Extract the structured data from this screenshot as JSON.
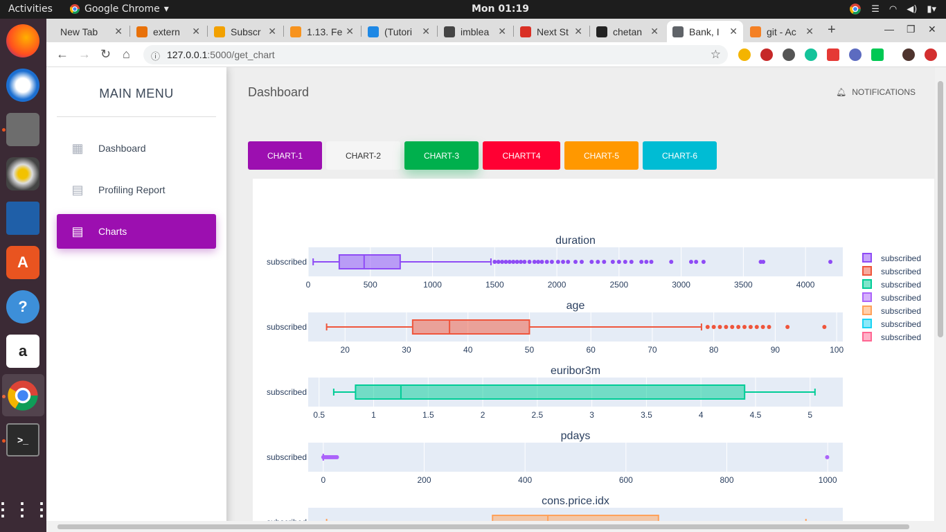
{
  "topbar": {
    "activities": "Activities",
    "app_name": "Google Chrome",
    "clock": "Mon 01:19"
  },
  "tabs": [
    {
      "label": "New Tab",
      "color": "#ffffff"
    },
    {
      "label": "extern",
      "color": "#e8710a"
    },
    {
      "label": "Subscr",
      "color": "#f2a100"
    },
    {
      "label": "1.13. Fe",
      "color": "#f7931e"
    },
    {
      "label": "(Tutori",
      "color": "#1e88e5"
    },
    {
      "label": "imblea",
      "color": "#444444"
    },
    {
      "label": "Next St",
      "color": "#d93025"
    },
    {
      "label": "chetan",
      "color": "#222222"
    },
    {
      "label": "Bank, I",
      "color": "#5f6368"
    },
    {
      "label": "git - Ac",
      "color": "#f48024"
    }
  ],
  "omnibox": {
    "host": "127.0.0.1",
    "path": ":5000/get_chart"
  },
  "sidebar": {
    "title": "MAIN MENU",
    "items": [
      {
        "label": "Dashboard",
        "icon": "dashboard-icon"
      },
      {
        "label": "Profiling Report",
        "icon": "report-icon"
      },
      {
        "label": "Charts",
        "icon": "charts-icon"
      }
    ]
  },
  "header": {
    "title": "Dashboard",
    "notifications": "NOTIFICATIONS"
  },
  "chart_buttons": [
    {
      "label": "CHART-1",
      "color": "#9c0fb0"
    },
    {
      "label": "CHART-2",
      "color": "#f5f5f5"
    },
    {
      "label": "CHART-3",
      "color": "#00b04d"
    },
    {
      "label": "CHARTT4",
      "color": "#ff0033"
    },
    {
      "label": "CHART-5",
      "color": "#ff9800"
    },
    {
      "label": "CHART-6",
      "color": "#00bcd4"
    }
  ],
  "chart_data": {
    "type": "box",
    "category_label": "subscribed",
    "legend": [
      "subscribed",
      "subscribed",
      "subscribed",
      "subscribed",
      "subscribed",
      "subscribed",
      "subscribed"
    ],
    "legend_colors": [
      "#8e4bf5",
      "#ef553b",
      "#00cc96",
      "#ab63fa",
      "#ffa15a",
      "#19d3f3",
      "#ff6692"
    ],
    "subplots": [
      {
        "title": "duration",
        "color": "#8e4bf5",
        "xlim": [
          0,
          4300
        ],
        "ticks": [
          0,
          500,
          1000,
          1500,
          2000,
          2500,
          3000,
          3500,
          4000
        ],
        "min": 40,
        "q1": 250,
        "median": 450,
        "q3": 740,
        "max": 1470,
        "outliers": [
          1500,
          1530,
          1560,
          1590,
          1620,
          1650,
          1680,
          1710,
          1740,
          1780,
          1820,
          1850,
          1880,
          1920,
          1960,
          2010,
          2050,
          2090,
          2150,
          2200,
          2280,
          2330,
          2380,
          2450,
          2500,
          2550,
          2600,
          2680,
          2720,
          2760,
          2920,
          3080,
          3120,
          3180,
          3640,
          3660,
          4200
        ]
      },
      {
        "title": "age",
        "color": "#ef553b",
        "xlim": [
          14,
          101
        ],
        "ticks": [
          20,
          30,
          40,
          50,
          60,
          70,
          80,
          90,
          100
        ],
        "min": 17,
        "q1": 31,
        "median": 37,
        "q3": 50,
        "max": 78,
        "outliers": [
          79,
          80,
          81,
          82,
          83,
          84,
          85,
          86,
          87,
          88,
          89,
          92,
          98
        ]
      },
      {
        "title": "euribor3m",
        "color": "#00cc96",
        "xlim": [
          0.4,
          5.3
        ],
        "ticks": [
          0.5,
          1,
          1.5,
          2,
          2.5,
          3,
          3.5,
          4,
          4.5,
          5
        ],
        "min": 0.634,
        "q1": 0.834,
        "median": 1.25,
        "q3": 4.4,
        "max": 5.045,
        "outliers": []
      },
      {
        "title": "pdays",
        "color": "#ab63fa",
        "xlim": [
          -30,
          1030
        ],
        "ticks": [
          0,
          200,
          400,
          600,
          800,
          1000
        ],
        "min": 0,
        "q1": 0,
        "median": 0,
        "q3": 0,
        "max": 0,
        "outliers": [
          0,
          3,
          6,
          9,
          12,
          15,
          18,
          21,
          24,
          27,
          999
        ]
      },
      {
        "title": "cons.price.idx",
        "color": "#ffa15a",
        "xlim": [
          92.1,
          95.0
        ],
        "ticks": [],
        "min": 92.2,
        "q1": 93.1,
        "median": 93.4,
        "q3": 94.0,
        "max": 94.8,
        "outliers": []
      }
    ]
  }
}
